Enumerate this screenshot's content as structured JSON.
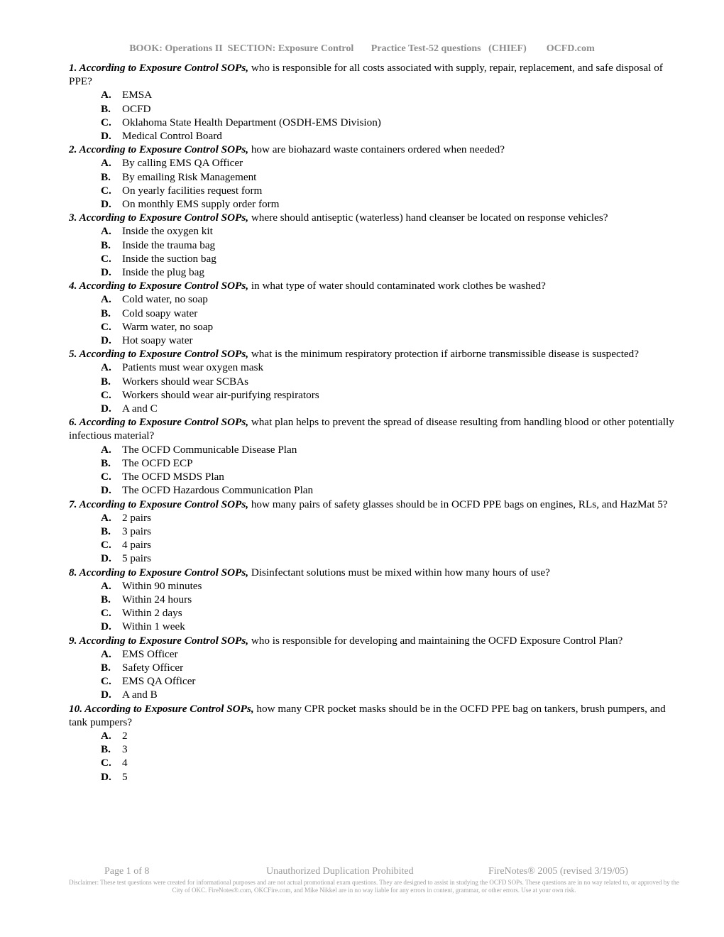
{
  "header": {
    "book": "BOOK: Operations II  SECTION: Exposure Control",
    "test": "Practice Test-52 questions   (CHIEF)",
    "site": "OCFD.com"
  },
  "questions": [
    {
      "number": "1.",
      "prefix": "According to Exposure Control SOPs,",
      "text": " who is responsible for all costs associated with supply, repair, replacement, and safe disposal of PPE?",
      "options": [
        {
          "letter": "A.",
          "text": "EMSA"
        },
        {
          "letter": "B.",
          "text": "OCFD"
        },
        {
          "letter": "C.",
          "text": "Oklahoma State Health Department (OSDH-EMS Division)"
        },
        {
          "letter": "D.",
          "text": "Medical Control Board"
        }
      ]
    },
    {
      "number": "2.",
      "prefix": "According to Exposure Control SOPs,",
      "text": " how are biohazard waste containers ordered when needed?",
      "options": [
        {
          "letter": "A.",
          "text": "By calling EMS QA Officer"
        },
        {
          "letter": "B.",
          "text": "By emailing Risk Management"
        },
        {
          "letter": "C.",
          "text": "On yearly facilities request form"
        },
        {
          "letter": "D.",
          "text": "On monthly EMS supply order form"
        }
      ]
    },
    {
      "number": "3.",
      "prefix": "According to Exposure Control SOPs,",
      "text": " where should antiseptic (waterless) hand cleanser be located on response vehicles?",
      "options": [
        {
          "letter": "A.",
          "text": "Inside the oxygen kit"
        },
        {
          "letter": "B.",
          "text": "Inside the trauma bag"
        },
        {
          "letter": "C.",
          "text": "Inside the suction bag"
        },
        {
          "letter": "D.",
          "text": "Inside the plug bag"
        }
      ]
    },
    {
      "number": "4.",
      "prefix": "According to Exposure Control SOPs,",
      "text": " in what type of water should contaminated work clothes be washed?",
      "options": [
        {
          "letter": "A.",
          "text": "Cold water, no soap"
        },
        {
          "letter": "B.",
          "text": "Cold soapy water"
        },
        {
          "letter": "C.",
          "text": "Warm water, no soap"
        },
        {
          "letter": "D.",
          "text": "Hot soapy water"
        }
      ]
    },
    {
      "number": "5.",
      "prefix": "According to Exposure Control SOPs,",
      "text": " what is the minimum respiratory protection if airborne transmissible disease is suspected?",
      "options": [
        {
          "letter": "A.",
          "text": "Patients must wear oxygen mask"
        },
        {
          "letter": "B.",
          "text": "Workers should wear SCBAs"
        },
        {
          "letter": "C.",
          "text": "Workers should wear air-purifying respirators"
        },
        {
          "letter": "D.",
          "text": "A and C"
        }
      ]
    },
    {
      "number": "6.",
      "prefix": "According to Exposure Control SOPs,",
      "text": " what plan helps to prevent the spread of disease resulting from handling blood or other potentially infectious material?",
      "options": [
        {
          "letter": "A.",
          "text": "The OCFD Communicable Disease Plan"
        },
        {
          "letter": "B.",
          "text": "The OCFD ECP"
        },
        {
          "letter": "C.",
          "text": "The OCFD MSDS Plan"
        },
        {
          "letter": "D.",
          "text": "The OCFD Hazardous Communication Plan"
        }
      ]
    },
    {
      "number": "7.",
      "prefix": "According to Exposure Control SOPs,",
      "text": " how many pairs of safety glasses should be in OCFD PPE bags on engines, RLs, and HazMat 5?",
      "options": [
        {
          "letter": "A.",
          "text": "2 pairs"
        },
        {
          "letter": "B.",
          "text": "3 pairs"
        },
        {
          "letter": "C.",
          "text": "4 pairs"
        },
        {
          "letter": "D.",
          "text": "5 pairs"
        }
      ]
    },
    {
      "number": "8.",
      "prefix": "According to Exposure Control SOPs,",
      "text": " Disinfectant solutions must be mixed within how many hours of use?",
      "options": [
        {
          "letter": "A.",
          "text": "Within 90 minutes"
        },
        {
          "letter": "B.",
          "text": "Within 24 hours"
        },
        {
          "letter": "C.",
          "text": "Within 2 days"
        },
        {
          "letter": "D.",
          "text": "Within 1 week"
        }
      ]
    },
    {
      "number": "9.",
      "prefix": "According to Exposure Control SOPs,",
      "text": " who is responsible for developing and maintaining the OCFD Exposure Control Plan?",
      "options": [
        {
          "letter": "A.",
          "text": "EMS Officer"
        },
        {
          "letter": "B.",
          "text": "Safety Officer"
        },
        {
          "letter": "C.",
          "text": "EMS QA Officer"
        },
        {
          "letter": "D.",
          "text": "A and B"
        }
      ]
    },
    {
      "number": "10.",
      "prefix": "According to Exposure Control SOPs,",
      "text": " how many CPR pocket masks should be in the OCFD PPE bag on tankers, brush pumpers, and tank pumpers?",
      "options": [
        {
          "letter": "A.",
          "text": "2"
        },
        {
          "letter": "B.",
          "text": "3"
        },
        {
          "letter": "C.",
          "text": "4"
        },
        {
          "letter": "D.",
          "text": "5"
        }
      ]
    }
  ],
  "footer": {
    "page": "Page 1 of 8",
    "duplication": "Unauthorized Duplication Prohibited",
    "firenotes": "FireNotes® 2005 (revised 3/19/05)",
    "disclaimer": "Disclaimer: These test questions were created for informational purposes and are not actual promotional exam questions.  They are designed to assist in studying the OCFD SOPs.  These questions are in no way related to, or approved by the City of OKC.  FireNotes®.com, OKCFire.com, and Mike Nikkel are in no way liable for any errors in content, grammar, or other errors.  Use at your own risk."
  }
}
